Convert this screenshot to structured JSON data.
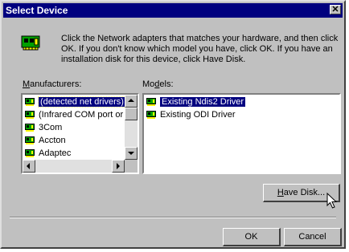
{
  "dialog": {
    "title": "Select Device",
    "close_glyph": "✕",
    "instructions": "Click the Network adapters that matches your hardware, and then click OK. If you don't know which model you have, click OK. If you have an installation disk for this device, click Have Disk."
  },
  "manufacturers": {
    "label_accel": "M",
    "label_rest": "anufacturers:",
    "items": [
      {
        "label": "(detected net drivers)",
        "icon": "network-card-icon"
      },
      {
        "label": "(Infrared COM port or dc",
        "icon": "network-card-icon"
      },
      {
        "label": "3Com",
        "icon": "network-card-icon"
      },
      {
        "label": "Accton",
        "icon": "network-card-icon"
      },
      {
        "label": "Adaptec",
        "icon": "network-card-icon"
      }
    ]
  },
  "models": {
    "label_pre": "Mo",
    "label_accel": "d",
    "label_rest": "els:",
    "items": [
      {
        "label": "Existing Ndis2 Driver",
        "icon": "network-card-icon"
      },
      {
        "label": "Existing ODI Driver",
        "icon": "network-card-icon"
      }
    ]
  },
  "buttons": {
    "have_disk_accel": "H",
    "have_disk_rest": "ave Disk...",
    "ok": "OK",
    "cancel": "Cancel"
  },
  "colors": {
    "title_bar": "#00007f",
    "face": "#c0c0c0",
    "selection": "#00007f",
    "icon_green": "#00a000",
    "icon_yellow": "#ffff00"
  }
}
